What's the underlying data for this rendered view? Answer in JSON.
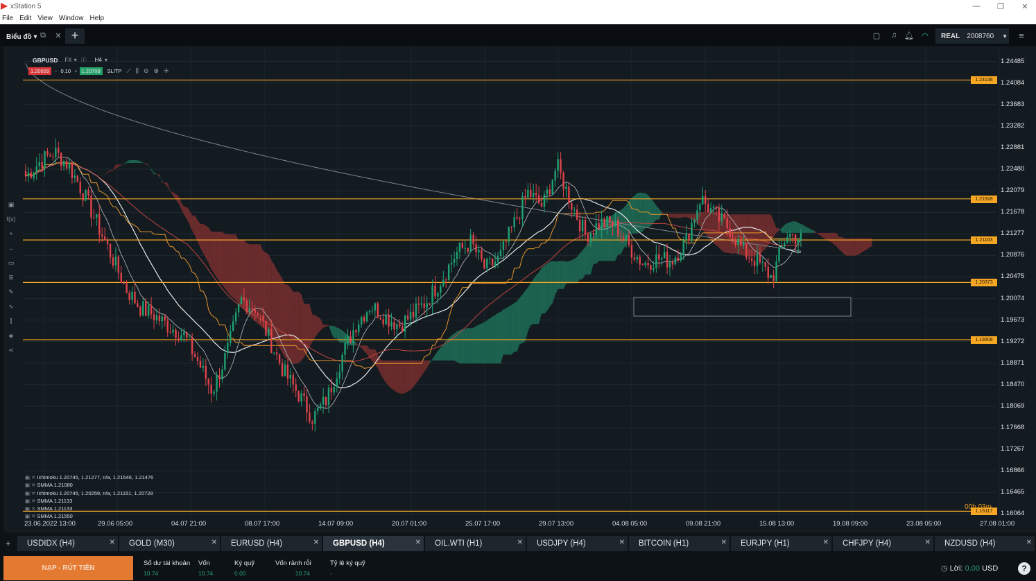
{
  "window": {
    "title": "xStation 5",
    "controls": [
      "—",
      "❐",
      "✕"
    ]
  },
  "menu": [
    "File",
    "Edit",
    "View",
    "Window",
    "Help"
  ],
  "toolbar": {
    "tab_label": "Biểu đồ",
    "add_label": "+",
    "account_mode": "REAL",
    "account_number": "2008760"
  },
  "chart_header": {
    "symbol": "GBPUSD",
    "market": "FX",
    "timeframe": "H4",
    "sell_price": "1.20699",
    "volume": "0.10",
    "buy_price": "1.20708",
    "sltp": "SL/TP"
  },
  "indicators": [
    "Ichimoku 1.20745, 1.21277, n/a, 1.21546, 1.21476",
    "SMMA 1.21080",
    "Ichimoku 1.20745, 1.20259, n/a, 1.21151, 1.20728",
    "SMMA 1.21133",
    "SMMA 1.21133",
    "SMMA 1.21550"
  ],
  "countdown": "00h 03m",
  "colors": {
    "bg": "#131b21",
    "bull": "#1fa172",
    "bear": "#e0434a",
    "level": "#f5a623",
    "cloud_green": "#1e6e57",
    "cloud_red": "#7a2e2e"
  },
  "chart_data": {
    "type": "candlestick",
    "symbol": "GBPUSD",
    "timeframe": "H4",
    "x_ticks": [
      "23.06.2022 13:00",
      "29.06 05:00",
      "04.07 21:00",
      "08.07 17:00",
      "14.07 09:00",
      "20.07 01:00",
      "25.07 17:00",
      "29.07 13:00",
      "04.08 05:00",
      "09.08 21:00",
      "15.08 13:00",
      "19.08 09:00",
      "23.08 05:00",
      "27.08 01:00"
    ],
    "y_ticks": [
      1.24485,
      1.24084,
      1.23683,
      1.23282,
      1.22881,
      1.2248,
      1.22079,
      1.21678,
      1.21277,
      1.20876,
      1.20475,
      1.20074,
      1.19673,
      1.19272,
      1.18871,
      1.1847,
      1.18069,
      1.17668,
      1.17267,
      1.16866,
      1.16465,
      1.16064
    ],
    "ylim": [
      1.1598,
      1.2475
    ],
    "horizontal_levels": [
      {
        "label": "1.24138",
        "value": 1.24138
      },
      {
        "label": "1.21928",
        "value": 1.21928
      },
      {
        "label": "1.21163",
        "value": 1.21163
      },
      {
        "label": "1.20373",
        "value": 1.20373
      },
      {
        "label": "1.19308",
        "value": 1.19308
      },
      {
        "label": "1.16117",
        "value": 1.16117
      }
    ],
    "close_path": [
      1.2235,
      1.2262,
      1.228,
      1.2255,
      1.2205,
      1.2145,
      1.2085,
      1.2025,
      1.199,
      1.1975,
      1.1955,
      1.194,
      1.189,
      1.1835,
      1.1905,
      1.2005,
      1.199,
      1.193,
      1.187,
      1.183,
      1.1785,
      1.1822,
      1.1898,
      1.196,
      1.1995,
      1.1975,
      1.1958,
      1.1978,
      1.2005,
      1.2045,
      1.2092,
      1.2112,
      1.2062,
      1.2082,
      1.2145,
      1.2205,
      1.2178,
      1.2255,
      1.2185,
      1.2125,
      1.2148,
      1.2145,
      1.2105,
      1.2072,
      1.2082,
      1.2078,
      1.2115,
      1.2195,
      1.2162,
      1.2138,
      1.2095,
      1.2075,
      1.2045,
      1.2128,
      1.2118
    ],
    "series": [
      {
        "name": "Ichimoku"
      },
      {
        "name": "SMMA"
      }
    ]
  },
  "instrument_tabs": [
    {
      "label": "USDIDX (H4)",
      "active": false
    },
    {
      "label": "GOLD (M30)",
      "active": false
    },
    {
      "label": "EURUSD (H4)",
      "active": false
    },
    {
      "label": "GBPUSD (H4)",
      "active": true
    },
    {
      "label": "OIL.WTI (H1)",
      "active": false
    },
    {
      "label": "USDJPY (H4)",
      "active": false
    },
    {
      "label": "BITCOIN (H1)",
      "active": false
    },
    {
      "label": "EURJPY (H1)",
      "active": false
    },
    {
      "label": "CHFJPY (H4)",
      "active": false
    },
    {
      "label": "NZDUSD (H4)",
      "active": false
    }
  ],
  "footer": {
    "deposit_label": "NẠP - RÚT TIỀN",
    "balance_label": "Số dư tài khoản",
    "balance_value": "10.74",
    "equity_label": "Vốn",
    "equity_value": "10.74",
    "margin_label": "Ký quỹ",
    "margin_value": "0.00",
    "free_margin_label": "Vốn rảnh rỗi",
    "free_margin_value": "10.74",
    "margin_level_label": "Tỷ lệ ký quỹ",
    "margin_level_value": "-",
    "profit_label": "Lời:",
    "profit_value": "0.00",
    "profit_currency": "USD",
    "help_label": "?"
  }
}
